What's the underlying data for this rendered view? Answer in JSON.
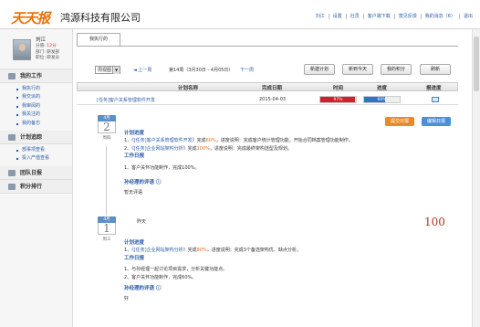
{
  "header": {
    "logo": "天天报",
    "company": "鸿源科技有限公司",
    "links": [
      "刘江",
      "设置",
      "社员",
      "客户端下载",
      "意见反馈",
      "我的消息（6）",
      "退出"
    ]
  },
  "user": {
    "name": "刘江",
    "l1": "分值:",
    "v1": "12分",
    "l2": "部门:",
    "v2": "研发部",
    "l3": "职位:",
    "v3": "研发员"
  },
  "sidebar": {
    "sections": [
      {
        "label": "我的工作",
        "items": [
          "我执行的",
          "我交派的",
          "我审阅的",
          "我关注的",
          "我的备忘"
        ]
      },
      {
        "label": "计划追踪",
        "items": [
          "部事项查看",
          "投入产值查看"
        ]
      },
      {
        "label": "团队日报",
        "items": []
      },
      {
        "label": "积分排行",
        "items": []
      }
    ]
  },
  "main": {
    "tab": "我执行的",
    "toolbar": {
      "period": "周视图",
      "prev": "◄ 上一周",
      "week": "第14周（3月30日 - 4月05日）",
      "next": "下一周",
      "b1": "新建计划",
      "b2": "新到今天",
      "b3": "我的积分",
      "b4": "刷新"
    },
    "table": {
      "h_name": "计划名称",
      "h_date": "完成日期",
      "h_time": "时间",
      "h_prog": "进度",
      "h_rpt": "报进度",
      "row": {
        "name": "[任务]客户关系管理软件开发",
        "date": "2015-04-03",
        "time_label": "97%",
        "time_pct": 97,
        "prog_label": "60%",
        "prog_pct": 60
      }
    },
    "btn_add": "提交日报",
    "btn_edit": "编辑日报",
    "entries": [
      {
        "month": "4月",
        "day": "2",
        "weekday": "周四",
        "plan_title": "计划进度",
        "plan1_pre": "1、",
        "plan1_link": "《[任务]客户关系管理软件开发》",
        "plan1_mid": "完成",
        "plan1_pct": "60%",
        "plan1_tail": "，进度说明：完成客户统计管理功能，开始合同档案管理功能制作。",
        "plan2_pre": "2、",
        "plan2_link": "《[任务]企业网站架构分析》",
        "plan2_mid": "完成",
        "plan2_pct": "100%",
        "plan2_tail": "，进度说明：完成最终架构选型及规划。",
        "work_title": "工作日报",
        "work1": "1、客户关怀功能制作，完成100%。",
        "rev_title": "孙经理的评语",
        "rev_text": "暂无评语"
      },
      {
        "month": "4月",
        "day": "1",
        "weekday": "周三",
        "note": "昨天",
        "plan_title": "计划进度",
        "plan1_pre": "1、",
        "plan1_link": "《[任务]企业网站架构分析》",
        "plan1_mid": "完成",
        "plan1_pct": "80%",
        "plan1_tail": "，进度说明：完成3个备选架构优、缺点分析。",
        "work_title": "工作日报",
        "work1": "1、与孙经理一起讨论项目需求，分析关键功能点。",
        "work2": "2、客户关怀功能制作，完成60%。",
        "rev_title": "孙经理的评语",
        "rev_text": "好"
      }
    ],
    "score": "100"
  },
  "colors": {
    "accent": "#2a5caa",
    "orange": "#e2711d",
    "red": "#d0202a",
    "blue_bar": "#2f74c4"
  }
}
